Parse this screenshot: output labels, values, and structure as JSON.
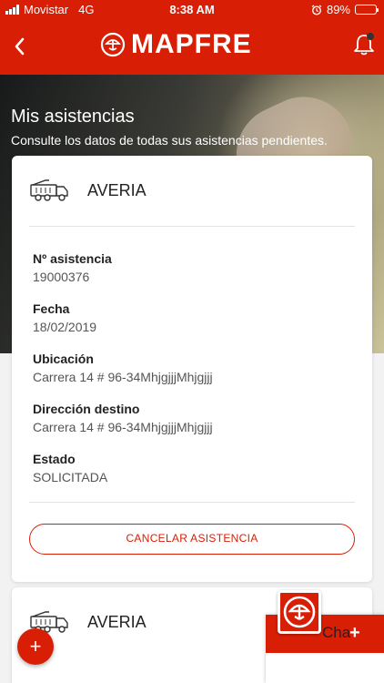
{
  "status_bar": {
    "carrier": "Movistar",
    "network": "4G",
    "time": "8:38 AM",
    "battery": "89%",
    "battery_level": 0.89
  },
  "nav": {
    "logo_text": "MAPFRE",
    "back_icon": "chevron-left-icon",
    "bell_icon": "bell-icon",
    "notification_dot": true
  },
  "hero": {
    "title": "Mis asistencias",
    "subtitle": "Consulte los datos de todas sus asistencias pendientes."
  },
  "assistances": [
    {
      "icon": "tow-truck-icon",
      "title": "AVERIA",
      "fields": [
        {
          "label": "Nº asistencia",
          "value": "19000376"
        },
        {
          "label": "Fecha",
          "value": "18/02/2019"
        },
        {
          "label": "Ubicación",
          "value": "Carrera 14 # 96-34MhjgjjjMhjgjjj"
        },
        {
          "label": "Dirección destino",
          "value": "Carrera 14 # 96-34MhjgjjjMhjgjjj"
        },
        {
          "label": "Estado",
          "value": "SOLICITADA"
        }
      ],
      "cancel_label": "CANCELAR ASISTENCIA"
    },
    {
      "icon": "tow-truck-icon",
      "title": "AVERIA"
    }
  ],
  "chat": {
    "label": "Cha",
    "plus": "+"
  },
  "fab": {
    "symbol": "+"
  },
  "colors": {
    "brand_red": "#d81e05",
    "background": "#f2f2f2",
    "card": "#ffffff"
  }
}
